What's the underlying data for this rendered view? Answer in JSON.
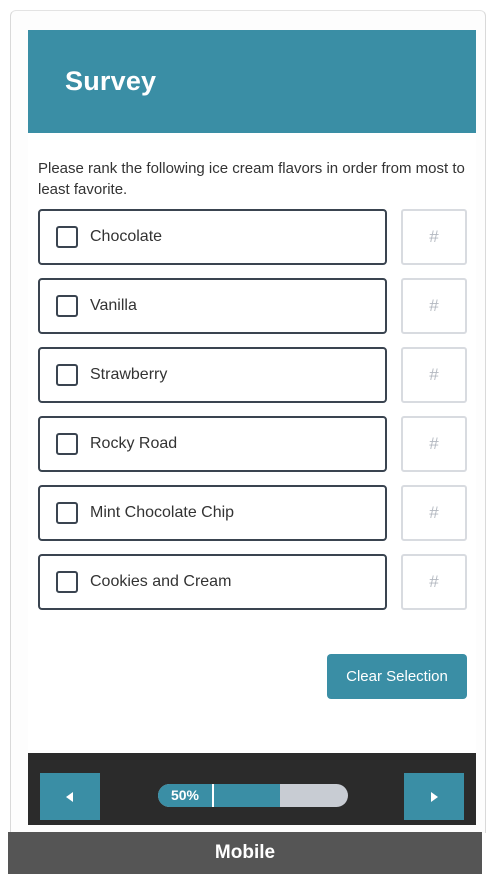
{
  "survey": {
    "title": "Survey",
    "prompt": "Please rank the following ice cream flavors in order from most to least favorite.",
    "options": [
      {
        "label": "Chocolate",
        "rank_placeholder": "#",
        "checked": false
      },
      {
        "label": "Vanilla",
        "rank_placeholder": "#",
        "checked": false
      },
      {
        "label": "Strawberry",
        "rank_placeholder": "#",
        "checked": false
      },
      {
        "label": "Rocky Road",
        "rank_placeholder": "#",
        "checked": false
      },
      {
        "label": "Mint Chocolate Chip",
        "rank_placeholder": "#",
        "checked": false
      },
      {
        "label": "Cookies and Cream",
        "rank_placeholder": "#",
        "checked": false
      }
    ],
    "clear_label": "Clear Selection"
  },
  "footer": {
    "prev_icon": "triangle-left-icon",
    "next_icon": "triangle-right-icon",
    "progress_value": 0.5,
    "progress_text": "50%"
  },
  "device_label": "Mobile",
  "colors": {
    "accent": "#3a8ea5",
    "footer_bg": "#2b2b2b",
    "border_dark": "#3a4450",
    "progress_track": "#c8ccd3"
  }
}
